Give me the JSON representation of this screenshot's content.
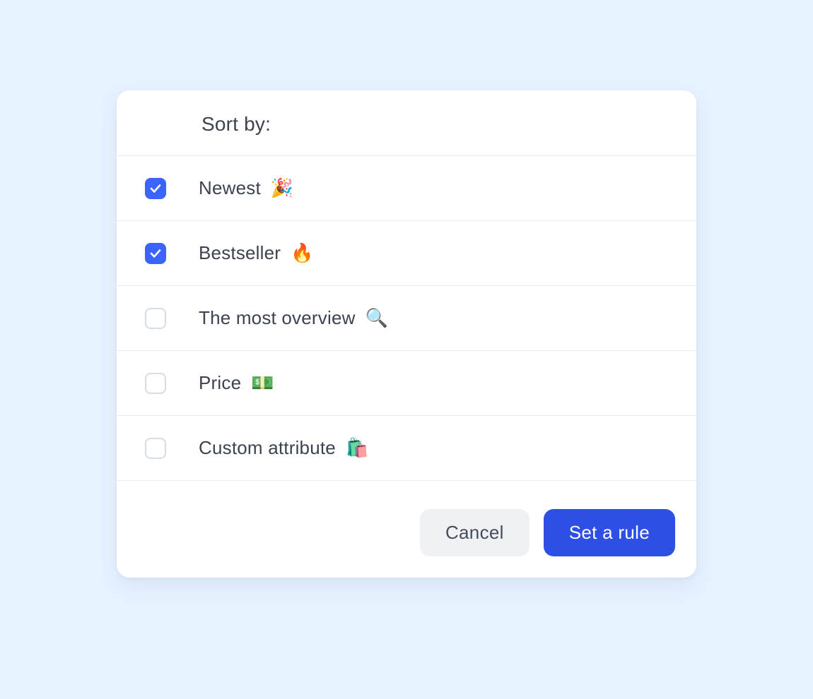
{
  "header": {
    "title": "Sort by:"
  },
  "options": [
    {
      "label": "Newest",
      "emoji": "🎉",
      "checked": true,
      "name": "option-newest"
    },
    {
      "label": "Bestseller",
      "emoji": "🔥",
      "checked": true,
      "name": "option-bestseller"
    },
    {
      "label": "The most overview",
      "emoji": "🔍",
      "checked": false,
      "name": "option-most-overview"
    },
    {
      "label": "Price",
      "emoji": "💵",
      "checked": false,
      "name": "option-price"
    },
    {
      "label": "Custom attribute",
      "emoji": "🛍️",
      "checked": false,
      "name": "option-custom-attribute"
    }
  ],
  "footer": {
    "cancel_label": "Cancel",
    "submit_label": "Set a rule"
  },
  "colors": {
    "page_bg": "#e6f2ff",
    "card_bg": "#ffffff",
    "accent": "#2e4fe3",
    "checkbox_checked": "#3a63ff",
    "text": "#3c4350",
    "divider": "#e9edf2",
    "cancel_bg": "#f0f1f4"
  }
}
